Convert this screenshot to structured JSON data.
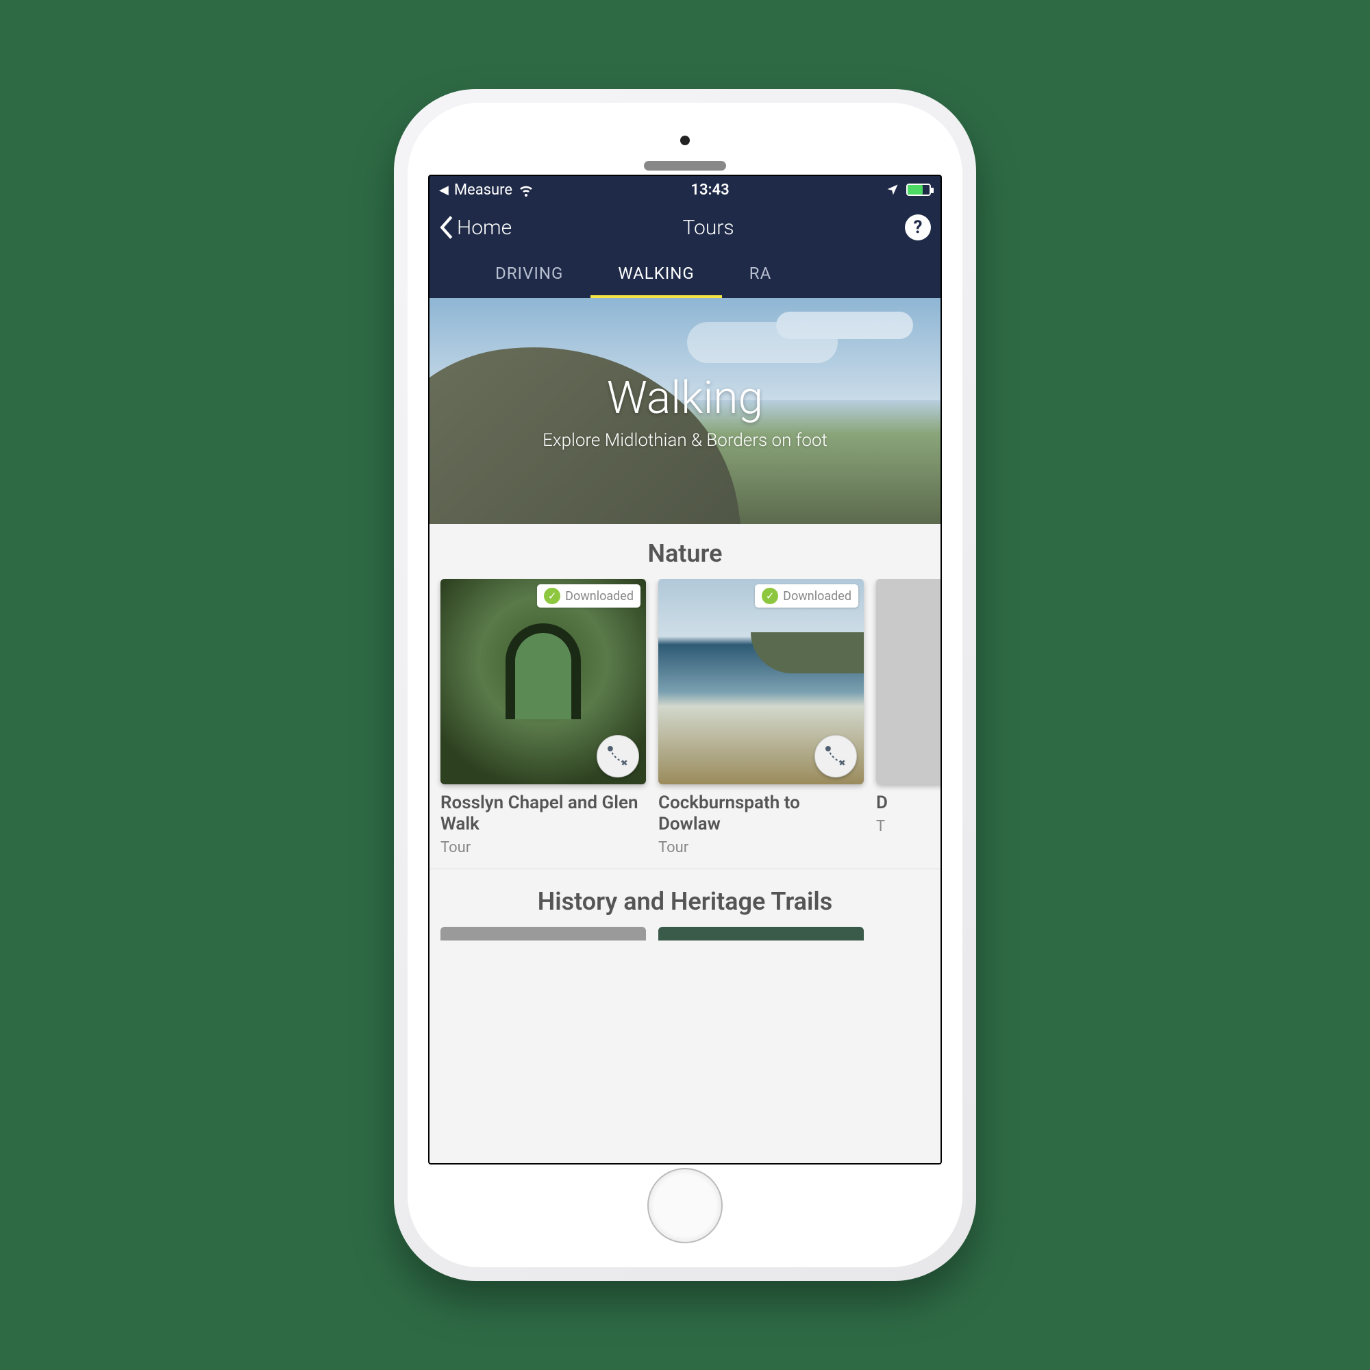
{
  "status": {
    "back_app": "Measure",
    "time": "13:43"
  },
  "nav": {
    "back_label": "Home",
    "title": "Tours",
    "help": "?"
  },
  "tabs": [
    "DRIVING",
    "WALKING",
    "RA"
  ],
  "hero": {
    "title": "Walking",
    "subtitle": "Explore Midlothian & Borders on foot"
  },
  "sections": [
    {
      "title": "Nature",
      "cards": [
        {
          "title": "Rosslyn Chapel and Glen Walk",
          "type": "Tour",
          "badge": "Downloaded"
        },
        {
          "title": "Cockburnspath to Dowlaw",
          "type": "Tour",
          "badge": "Downloaded"
        },
        {
          "title": "D",
          "type": "T",
          "badge": ""
        }
      ]
    },
    {
      "title": "History and Heritage Trails",
      "cards": []
    }
  ]
}
